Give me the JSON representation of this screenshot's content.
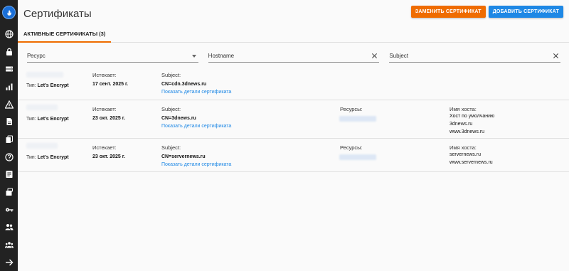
{
  "sidebar": {
    "items": [
      {
        "icon": "globe-icon"
      },
      {
        "icon": "lock-icon"
      },
      {
        "icon": "server-icon"
      },
      {
        "icon": "chart-icon"
      },
      {
        "icon": "warning-icon"
      },
      {
        "icon": "document-icon"
      },
      {
        "icon": "copy-icon"
      },
      {
        "icon": "help-icon"
      },
      {
        "icon": "notes-icon"
      },
      {
        "icon": "certificate-icon"
      },
      {
        "icon": "key-icon"
      },
      {
        "icon": "users-icon"
      },
      {
        "icon": "group-icon"
      },
      {
        "icon": "arrow-right-icon"
      }
    ]
  },
  "header": {
    "title": "Сертификаты",
    "replace_label": "ЗАМЕНИТЬ СЕРТИФИКАТ",
    "add_label": "ДОБАВИТЬ СЕРТИФИКАТ"
  },
  "tabs": {
    "active_label": "АКТИВНЫЕ СЕРТИФИКАТЫ (3)"
  },
  "filters": {
    "resource_placeholder": "Ресурс",
    "hostname_placeholder": "Hostname",
    "subject_placeholder": "Subject"
  },
  "labels": {
    "type_prefix": "Тип:",
    "expires": "Истекает:",
    "subject": "Subject:",
    "details_link": "Показать детали сертификата",
    "resources": "Ресурсы:",
    "hostname": "Имя хоста:"
  },
  "certificates": [
    {
      "type": "Let's Encrypt",
      "expires": "17 сент. 2025 г.",
      "subject": "CN=cdn.3dnews.ru",
      "hosts": []
    },
    {
      "type": "Let's Encrypt",
      "expires": "23 окт. 2025 г.",
      "subject": "CN=3dnews.ru",
      "hosts": [
        "Хост по умолчанию",
        "3dnews.ru",
        "www.3dnews.ru"
      ]
    },
    {
      "type": "Let's Encrypt",
      "expires": "23 окт. 2025 г.",
      "subject": "CN=servernews.ru",
      "hosts": [
        "servernews.ru",
        "www.servernews.ru"
      ]
    }
  ],
  "colors": {
    "sidebar": "#222222",
    "orange": "#ef6c00",
    "blue": "#1e88e5",
    "link": "#1e88e5"
  }
}
